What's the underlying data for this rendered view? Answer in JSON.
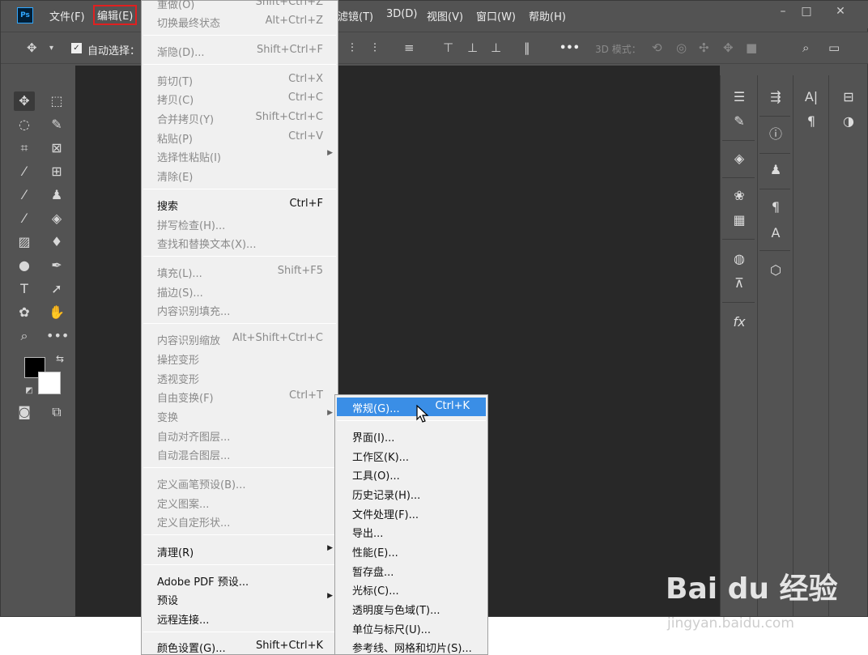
{
  "app": {
    "logo": "Ps",
    "menus": [
      "文件(F)",
      "编辑(E)",
      "滤镜(T)",
      "3D(D)",
      "视图(V)",
      "窗口(W)",
      "帮助(H)"
    ],
    "window_controls": [
      "–",
      "□",
      "✕"
    ]
  },
  "options_bar": {
    "auto_select_label": "自动选择：",
    "mode_3d_label": "3D 模式：",
    "more_label": "•••"
  },
  "edit_menu": {
    "items": [
      {
        "label": "重做(O)",
        "shortcut": "Shift+Ctrl+Z",
        "disabled": true
      },
      {
        "label": "切换最终状态",
        "shortcut": "Alt+Ctrl+Z",
        "disabled": true
      },
      {
        "label": "渐隐(D)...",
        "shortcut": "Shift+Ctrl+F",
        "disabled": true
      },
      {
        "label": "剪切(T)",
        "shortcut": "Ctrl+X",
        "disabled": true
      },
      {
        "label": "拷贝(C)",
        "shortcut": "Ctrl+C",
        "disabled": true
      },
      {
        "label": "合并拷贝(Y)",
        "shortcut": "Shift+Ctrl+C",
        "disabled": true
      },
      {
        "label": "粘贴(P)",
        "shortcut": "Ctrl+V",
        "disabled": true
      },
      {
        "label": "选择性粘贴(I)",
        "shortcut": "",
        "disabled": true,
        "submenu": true
      },
      {
        "label": "清除(E)",
        "shortcut": "",
        "disabled": true
      },
      {
        "label": "搜索",
        "shortcut": "Ctrl+F",
        "disabled": false
      },
      {
        "label": "拼写检查(H)...",
        "shortcut": "",
        "disabled": true
      },
      {
        "label": "查找和替换文本(X)...",
        "shortcut": "",
        "disabled": true
      },
      {
        "label": "填充(L)...",
        "shortcut": "Shift+F5",
        "disabled": true
      },
      {
        "label": "描边(S)...",
        "shortcut": "",
        "disabled": true
      },
      {
        "label": "内容识别填充...",
        "shortcut": "",
        "disabled": true
      },
      {
        "label": "内容识别缩放",
        "shortcut": "Alt+Shift+Ctrl+C",
        "disabled": true
      },
      {
        "label": "操控变形",
        "shortcut": "",
        "disabled": true
      },
      {
        "label": "透视变形",
        "shortcut": "",
        "disabled": true
      },
      {
        "label": "自由变换(F)",
        "shortcut": "Ctrl+T",
        "disabled": true
      },
      {
        "label": "变换",
        "shortcut": "",
        "disabled": true,
        "submenu": true
      },
      {
        "label": "自动对齐图层...",
        "shortcut": "",
        "disabled": true
      },
      {
        "label": "自动混合图层...",
        "shortcut": "",
        "disabled": true
      },
      {
        "label": "定义画笔预设(B)...",
        "shortcut": "",
        "disabled": true
      },
      {
        "label": "定义图案...",
        "shortcut": "",
        "disabled": true
      },
      {
        "label": "定义自定形状...",
        "shortcut": "",
        "disabled": true
      },
      {
        "label": "清理(R)",
        "shortcut": "",
        "disabled": false,
        "submenu": true
      },
      {
        "label": "Adobe PDF 预设...",
        "shortcut": "",
        "disabled": false
      },
      {
        "label": "预设",
        "shortcut": "",
        "disabled": false,
        "submenu": true
      },
      {
        "label": "远程连接...",
        "shortcut": "",
        "disabled": false
      },
      {
        "label": "颜色设置(G)...",
        "shortcut": "Shift+Ctrl+K",
        "disabled": false
      }
    ]
  },
  "preferences_submenu": {
    "items": [
      {
        "label": "常规(G)...",
        "shortcut": "Ctrl+K",
        "highlighted": true
      },
      {
        "label": "界面(I)...",
        "shortcut": ""
      },
      {
        "label": "工作区(K)...",
        "shortcut": ""
      },
      {
        "label": "工具(O)...",
        "shortcut": ""
      },
      {
        "label": "历史记录(H)...",
        "shortcut": ""
      },
      {
        "label": "文件处理(F)...",
        "shortcut": ""
      },
      {
        "label": "导出...",
        "shortcut": ""
      },
      {
        "label": "性能(E)...",
        "shortcut": ""
      },
      {
        "label": "暂存盘...",
        "shortcut": ""
      },
      {
        "label": "光标(C)...",
        "shortcut": ""
      },
      {
        "label": "透明度与色域(T)...",
        "shortcut": ""
      },
      {
        "label": "单位与标尺(U)...",
        "shortcut": ""
      },
      {
        "label": "参考线、网格和切片(S)...",
        "shortcut": ""
      }
    ]
  },
  "watermark": {
    "brand": "Bai du 经验",
    "site": "jingyan.baidu.com"
  },
  "colors": {
    "ui_bg": "#535353",
    "canvas_bg": "#282828",
    "menu_bg": "#f0f0f0",
    "highlight": "#3a8ee6",
    "active_outline": "#e02020"
  }
}
